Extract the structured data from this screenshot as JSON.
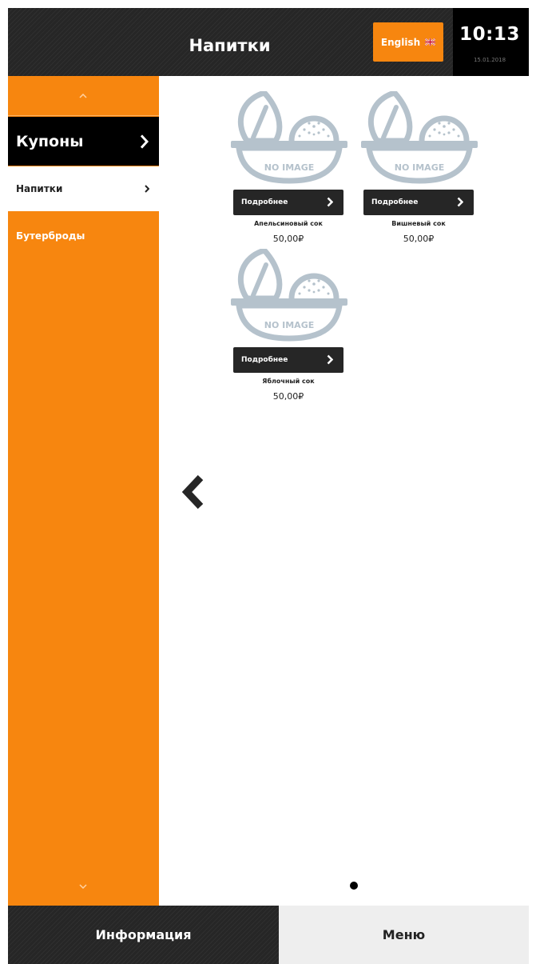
{
  "header": {
    "title": "Напитки",
    "language_button": "English",
    "language_flag_icon": "uk-flag-icon",
    "clock_time": "10:13",
    "clock_date": "15.01.2018"
  },
  "sidebar": {
    "scroll_up_icon": "chevron-up-icon",
    "scroll_down_icon": "chevron-down-icon",
    "categories": [
      {
        "label": "Купоны",
        "state": "active"
      },
      {
        "label": "Напитки",
        "state": "selected"
      },
      {
        "label": "Бутерброды",
        "state": "normal"
      }
    ]
  },
  "products": [
    {
      "image_text": "NO IMAGE",
      "details_label": "Подробнее",
      "name": "Апельсиновый сок",
      "price": "50,00₽"
    },
    {
      "image_text": "NO IMAGE",
      "details_label": "Подробнее",
      "name": "Вишневый сок",
      "price": "50,00₽"
    },
    {
      "image_text": "NO IMAGE",
      "details_label": "Подробнее",
      "name": "Яблочный сок",
      "price": "50,00₽"
    }
  ],
  "pagination": {
    "prev_icon": "chevron-left-icon",
    "current_page": 1,
    "total_pages": 1
  },
  "footer": {
    "info_tab": "Информация",
    "menu_tab": "Меню"
  },
  "colors": {
    "accent": "#f7860f",
    "dark": "#262626",
    "placeholder": "#b5c2cc"
  }
}
